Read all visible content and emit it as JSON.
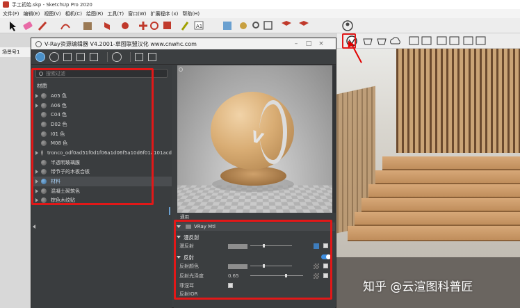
{
  "sketchup": {
    "title": "手工初始.skp - SketchUp Pro 2020",
    "menu": [
      "文件(F)",
      "编辑(E)",
      "视图(V)",
      "相机(C)",
      "绘图(R)",
      "工具(T)",
      "窗口(W)",
      "扩展程序 (x)",
      "帮助(H)"
    ],
    "scene_label": "场景号1"
  },
  "vray_window": {
    "title": "V-Ray资源编辑器 V4.2001-草图联盟汉化 www.cnwhc.com",
    "controls": {
      "minimize": "–",
      "maximize": "□",
      "close": "×"
    }
  },
  "material_list": {
    "search_placeholder": "搜索过滤",
    "header": "材质",
    "items": [
      {
        "label": "A05 色",
        "expandable": true
      },
      {
        "label": "A06 色",
        "expandable": true
      },
      {
        "label": "C04 色",
        "expandable": false
      },
      {
        "label": "D02 色",
        "expandable": false
      },
      {
        "label": "I01 色",
        "expandable": false
      },
      {
        "label": "M08 色",
        "expandable": false
      },
      {
        "label": "tronco_odf0ad51f0d1f06a1d06f5a10d6f01a101acd",
        "expandable": true
      },
      {
        "label": "半透明玻璃膜",
        "expandable": false
      },
      {
        "label": "带节子的木板合板",
        "expandable": true
      },
      {
        "label": "材料",
        "expandable": true,
        "selected": true
      },
      {
        "label": "混凝土砌筑色",
        "expandable": true
      },
      {
        "label": "棕色木纹贴",
        "expandable": true
      }
    ]
  },
  "preview": {
    "tab_label": "通用"
  },
  "properties": {
    "material_type": "VRay Mtl",
    "sections": [
      {
        "title": "漫反射",
        "rows": [
          {
            "label": "漫反射",
            "value": ""
          }
        ]
      },
      {
        "title": "反射",
        "rows": [
          {
            "label": "反射颜色",
            "value": ""
          },
          {
            "label": "反射光泽度",
            "value": "0.65"
          },
          {
            "label": "菲涅耳",
            "value": ""
          }
        ]
      }
    ],
    "cut_off_label": "反射IOR"
  },
  "colors": {
    "highlight": "#e21818",
    "vray_bg": "#3c3f41",
    "accent": "#3e8ee0"
  },
  "watermark": "知乎 @云渲图科普匠"
}
